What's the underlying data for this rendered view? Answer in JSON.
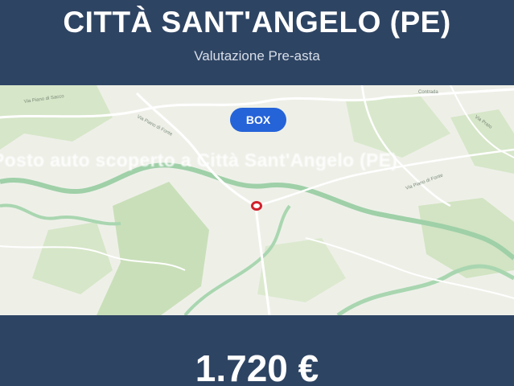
{
  "header": {
    "title": "CITTÀ SANT'ANGELO (PE)",
    "subtitle": "Valutazione Pre-asta"
  },
  "map": {
    "badge_label": "BOX",
    "overlay_text": "Posto auto scoperto a Città Sant'Angelo (PE)",
    "pin_icon": "location-marker-icon",
    "colors": {
      "badge": "#2563d8",
      "pin": "#d0202c",
      "land": "#eef0e8",
      "green_area": "#c9dfb9",
      "river": "#9fd0a8"
    }
  },
  "footer": {
    "price": "1.720 €"
  },
  "colors": {
    "banner": "#2e4463",
    "text": "#ffffff"
  }
}
